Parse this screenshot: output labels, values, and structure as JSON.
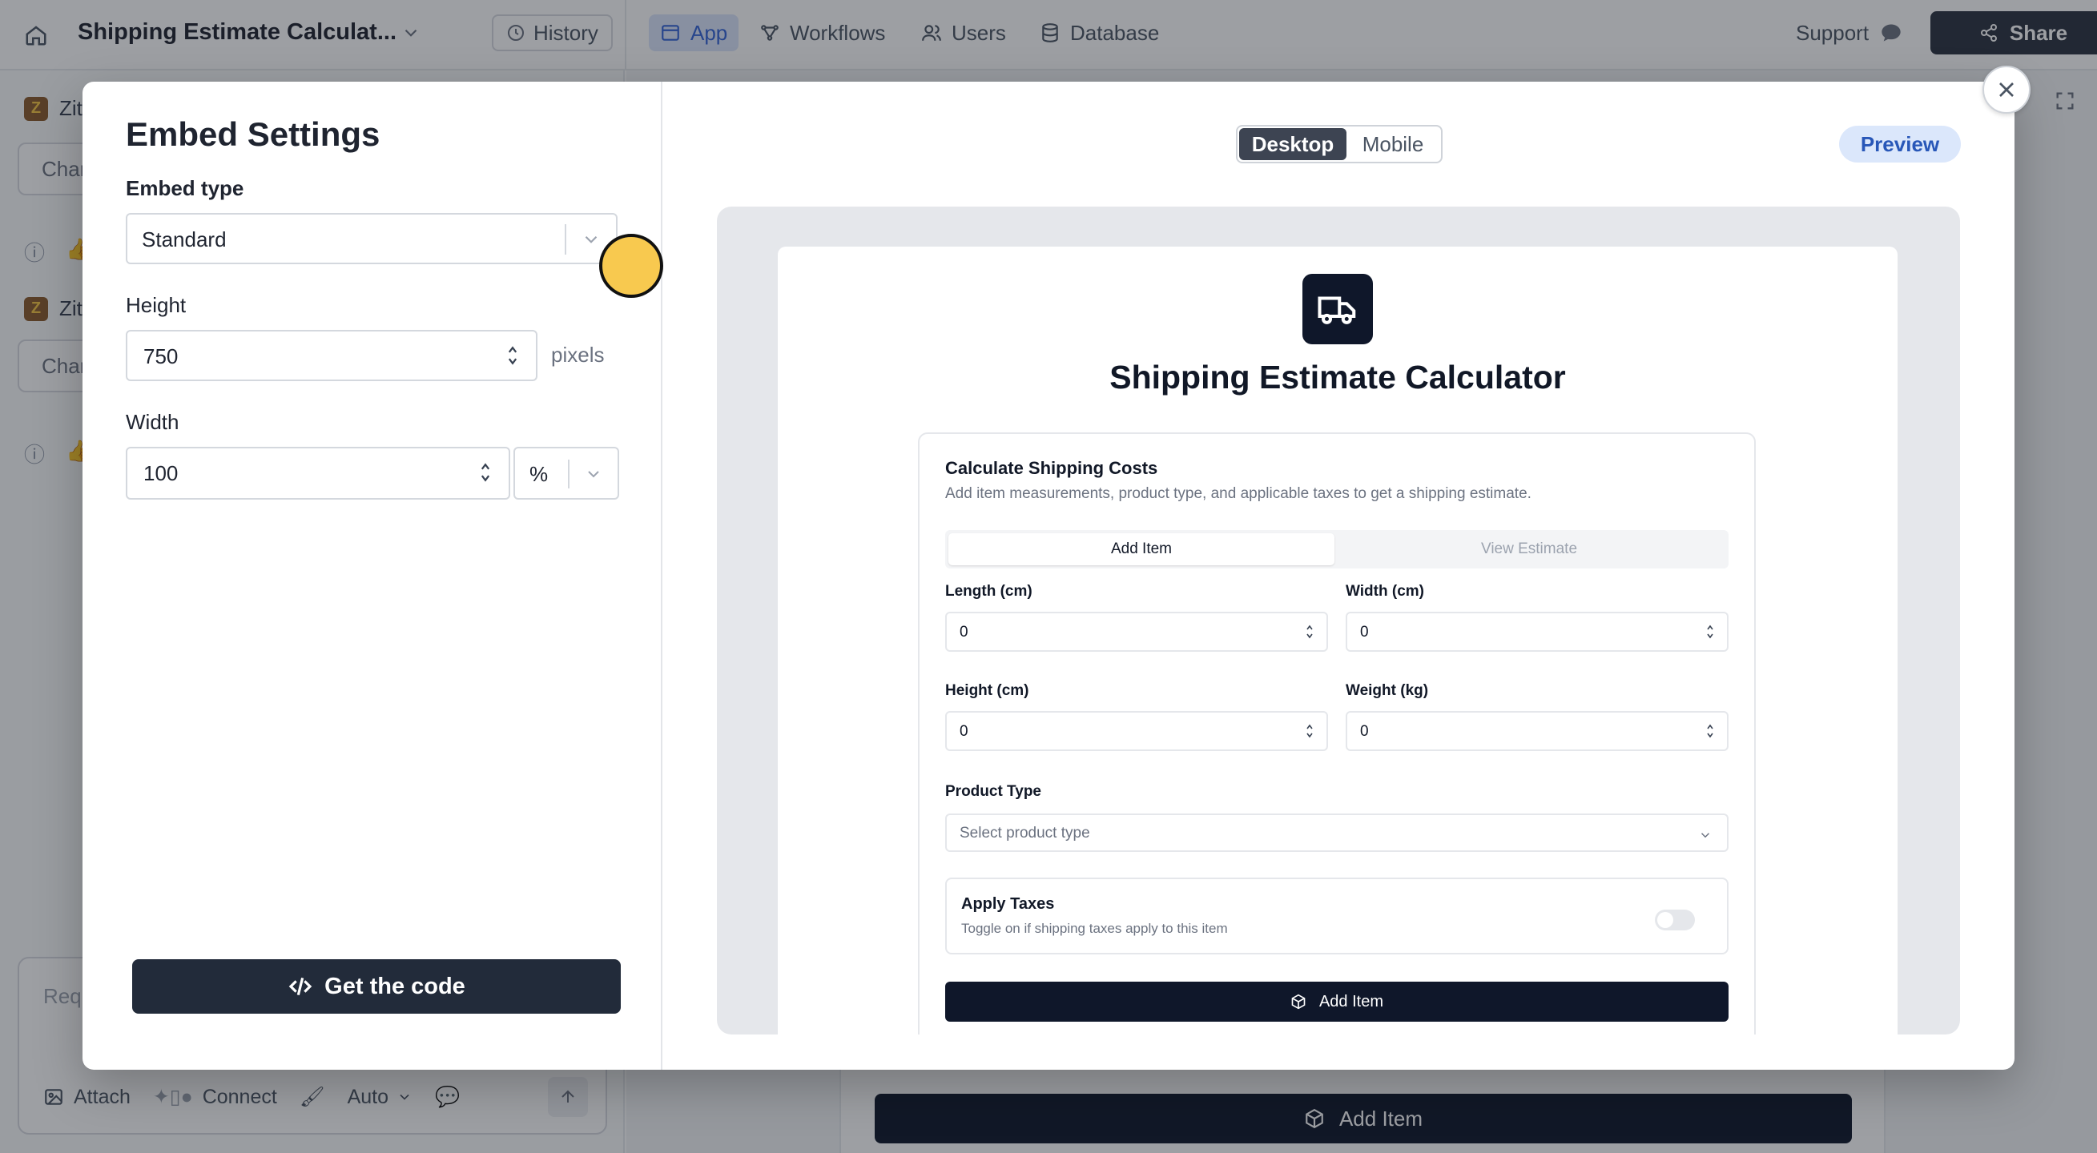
{
  "topbar": {
    "app_title": "Shipping Estimate Calculat...",
    "history_label": "History",
    "nav": [
      {
        "label": "App",
        "icon": "layout-icon"
      },
      {
        "label": "Workflows",
        "icon": "workflow-icon"
      },
      {
        "label": "Users",
        "icon": "users-icon"
      },
      {
        "label": "Database",
        "icon": "database-icon"
      }
    ],
    "support_label": "Support",
    "share_label": "Share"
  },
  "left_pane": {
    "agent_name_1": "Zit",
    "button_1": "Char",
    "agent_name_2": "Zit",
    "button_2": "Char",
    "composer_placeholder": "Requ",
    "attach_label": "Attach",
    "connect_label": "Connect",
    "mode_label": "Auto"
  },
  "canvas": {
    "add_item_label": "Add Item"
  },
  "modal": {
    "title": "Embed Settings",
    "embed_type_label": "Embed type",
    "embed_type_value": "Standard",
    "height_label": "Height",
    "height_value": "750",
    "height_unit": "pixels",
    "width_label": "Width",
    "width_value": "100",
    "width_unit": "%",
    "get_code_label": "Get the code",
    "view_modes": [
      "Desktop",
      "Mobile"
    ],
    "active_view_mode": "Desktop",
    "preview_label": "Preview"
  },
  "preview": {
    "page_title": "Shipping Estimate Calculator",
    "card_title": "Calculate Shipping Costs",
    "card_subtitle": "Add item measurements, product type, and applicable taxes to get a shipping estimate.",
    "tabs": [
      "Add Item",
      "View Estimate"
    ],
    "fields": {
      "length_label": "Length (cm)",
      "length_value": "0",
      "width_label": "Width (cm)",
      "width_value": "0",
      "height_label": "Height (cm)",
      "height_value": "0",
      "weight_label": "Weight (kg)",
      "weight_value": "0"
    },
    "product_type_label": "Product Type",
    "product_type_placeholder": "Select product type",
    "taxes_title": "Apply Taxes",
    "taxes_subtitle": "Toggle on if shipping taxes apply to this item",
    "taxes_enabled": false,
    "add_item_button": "Add Item"
  },
  "colors": {
    "accent_dark": "#222b3a",
    "nav_active_bg": "#dbe6fb",
    "nav_active_text": "#3565d8",
    "cursor_marker": "#f8c94f"
  }
}
